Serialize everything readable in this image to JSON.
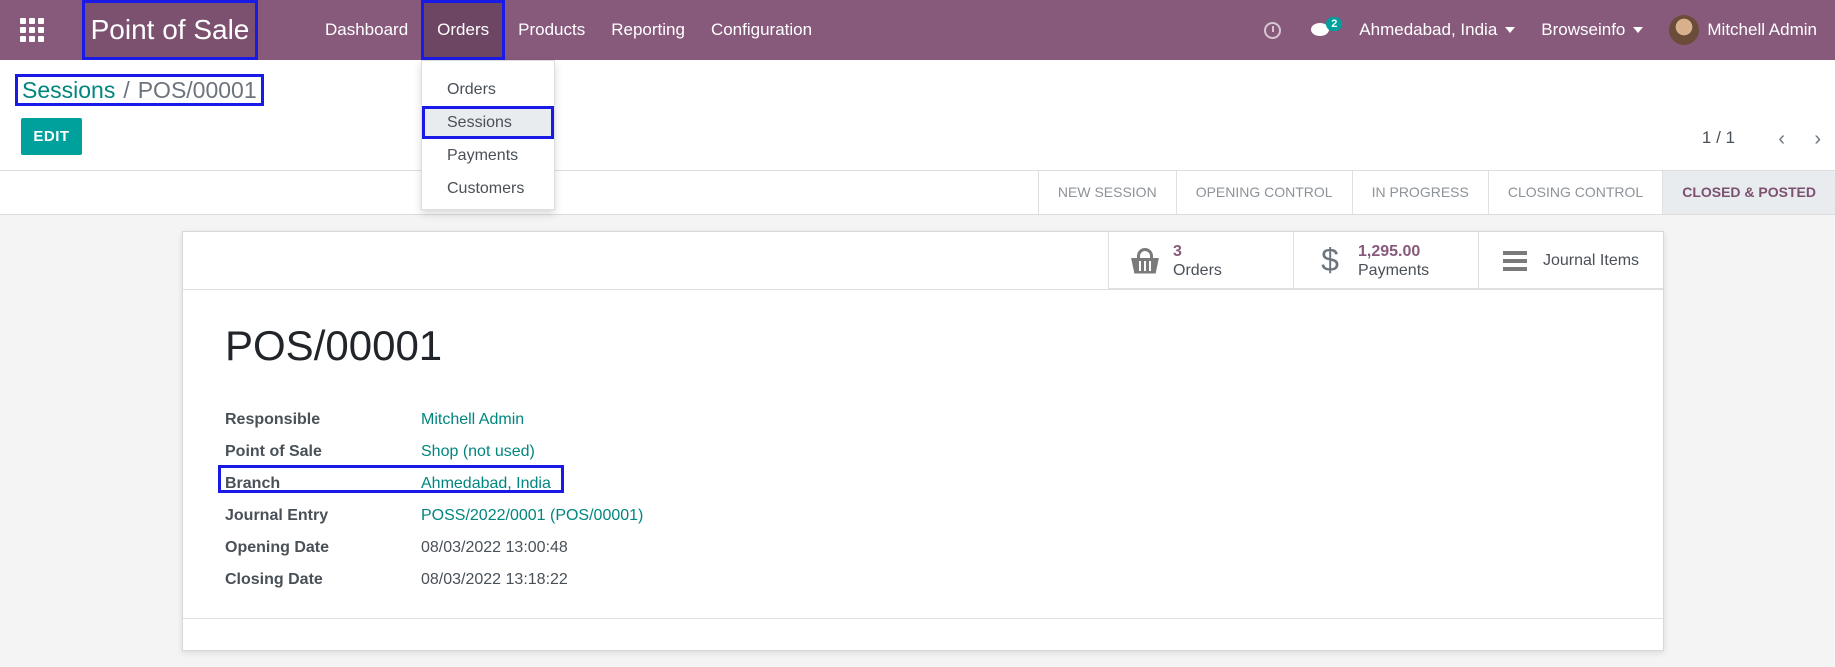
{
  "navbar": {
    "app_title": "Point of Sale",
    "menu": [
      "Dashboard",
      "Orders",
      "Products",
      "Reporting",
      "Configuration"
    ],
    "active_menu": "Orders",
    "chat_count": "2",
    "branch": "Ahmedabad, India",
    "company": "Browseinfo",
    "user": "Mitchell Admin"
  },
  "dropdown": {
    "items": [
      "Orders",
      "Sessions",
      "Payments",
      "Customers"
    ],
    "active": "Sessions"
  },
  "breadcrumb": {
    "parent": "Sessions",
    "separator": "/",
    "current": "POS/00001"
  },
  "control": {
    "edit_label": "EDIT",
    "pager": "1 / 1",
    "prev": "‹",
    "next": "›"
  },
  "statusbar": {
    "stages": [
      "New Session",
      "Opening Control",
      "In Progress",
      "Closing Control",
      "Closed & Posted"
    ],
    "current": "Closed & Posted"
  },
  "stat_buttons": {
    "orders": {
      "value": "3",
      "label": "Orders"
    },
    "payments": {
      "value": "1,295.00",
      "label": "Payments",
      "icon": "$"
    },
    "journal": {
      "label": "Journal Items"
    }
  },
  "record": {
    "title": "POS/00001",
    "fields": [
      {
        "label": "Responsible",
        "value": "Mitchell Admin"
      },
      {
        "label": "Point of Sale",
        "value": "Shop (not used)"
      },
      {
        "label": "Branch",
        "value": "Ahmedabad, India"
      },
      {
        "label": "Journal Entry",
        "value": "POSS/2022/0001 (POS/00001)"
      },
      {
        "label": "Opening Date",
        "value": "08/03/2022 13:00:48"
      },
      {
        "label": "Closing Date",
        "value": "08/03/2022 13:18:22"
      }
    ]
  },
  "colors": {
    "brand": "#875a7b",
    "accent": "#00a09d",
    "link": "#00867e",
    "highlight": "#1a1ae6"
  }
}
